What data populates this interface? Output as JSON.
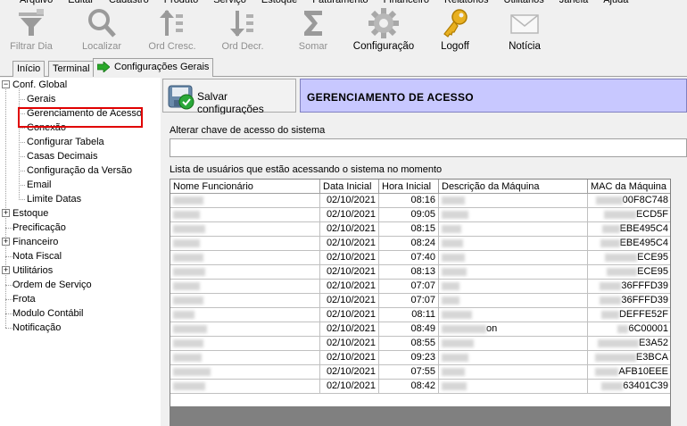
{
  "menu": [
    "Arquivo",
    "Editar",
    "Cadastro",
    "Produto",
    "Serviço",
    "Estoque",
    "Faturamento",
    "Financeiro",
    "Relatórios",
    "Utilitários",
    "Janela",
    "Ajuda"
  ],
  "toolbar": {
    "filtrar": "Filtrar Dia",
    "localizar": "Localizar",
    "ord_cresc": "Ord Cresc.",
    "ord_decr": "Ord Decr.",
    "somar": "Somar",
    "configuracao": "Configuração",
    "logoff": "Logoff",
    "noticia": "Notícia"
  },
  "tabs": [
    "Início",
    "Terminal",
    "Configurações Gerais"
  ],
  "tree": {
    "conf_global": "Conf. Global",
    "gerais": "Gerais",
    "gerenciamento": "Gerenciamento de Acesso",
    "conexao": "Conexão",
    "configurar_tabela": "Configurar Tabela",
    "casas_decimais": "Casas Decimais",
    "config_versao": "Configuração da Versão",
    "email": "Email",
    "limite_datas": "Limite Datas",
    "estoque": "Estoque",
    "precificacao": "Precificação",
    "financeiro": "Financeiro",
    "nota_fiscal": "Nota Fiscal",
    "utilitarios": "Utilitários",
    "ordem_servico": "Ordem de Serviço",
    "frota": "Frota",
    "modulo_contabil": "Modulo Contábil",
    "notificacao": "Notificação"
  },
  "save_button": "Salvar configurações",
  "header_title": "GERENCIAMENTO DE ACESSO",
  "access_key_label": "Alterar chave de acesso do sistema",
  "access_key_value": "",
  "list_label": "Lista de usuários que estão acessando o sistema no momento",
  "columns": [
    "Nome Funcionário",
    "Data Inicial",
    "Hora Inicial",
    "Descrição da Máquina",
    "MAC da Máquina"
  ],
  "rows": [
    {
      "date": "02/10/2021",
      "time": "08:16",
      "desc": "",
      "mac": "00F8C748"
    },
    {
      "date": "02/10/2021",
      "time": "09:05",
      "desc": "",
      "mac": "ECD5F"
    },
    {
      "date": "02/10/2021",
      "time": "08:15",
      "desc": "",
      "mac": "EBE495C4"
    },
    {
      "date": "02/10/2021",
      "time": "08:24",
      "desc": "",
      "mac": "EBE495C4"
    },
    {
      "date": "02/10/2021",
      "time": "07:40",
      "desc": "",
      "mac": "ECE95"
    },
    {
      "date": "02/10/2021",
      "time": "08:13",
      "desc": "",
      "mac": "ECE95"
    },
    {
      "date": "02/10/2021",
      "time": "07:07",
      "desc": "",
      "mac": "36FFFD39"
    },
    {
      "date": "02/10/2021",
      "time": "07:07",
      "desc": "",
      "mac": "36FFFD39"
    },
    {
      "date": "02/10/2021",
      "time": "08:11",
      "desc": "",
      "mac": "DEFFE52F"
    },
    {
      "date": "02/10/2021",
      "time": "08:49",
      "desc": "on",
      "mac": "6C00001"
    },
    {
      "date": "02/10/2021",
      "time": "08:55",
      "desc": "",
      "mac": "E3A52"
    },
    {
      "date": "02/10/2021",
      "time": "09:23",
      "desc": "",
      "mac": "E3BCA"
    },
    {
      "date": "02/10/2021",
      "time": "07:55",
      "desc": "",
      "mac": "AFB10EEE"
    },
    {
      "date": "02/10/2021",
      "time": "08:42",
      "desc": "",
      "mac": "63401C39"
    }
  ]
}
